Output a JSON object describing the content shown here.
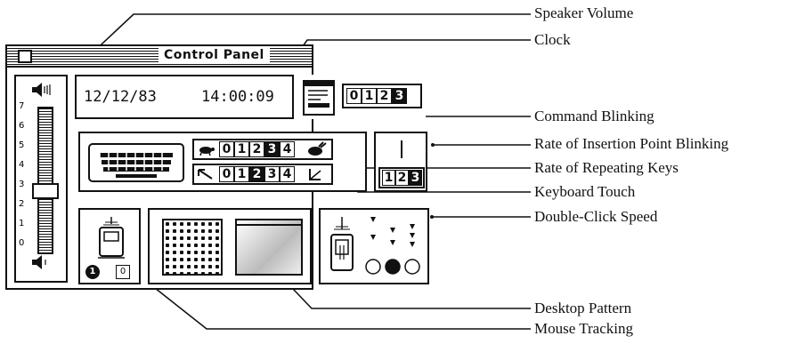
{
  "window": {
    "title": "Control Panel"
  },
  "clock": {
    "date": "12/12/83",
    "time": "14:00:09"
  },
  "command_blinking": {
    "digits": [
      "0",
      "1",
      "2",
      "3"
    ],
    "selected": 3
  },
  "insertion_blinking": {
    "digits": [
      "1",
      "2",
      "3"
    ],
    "selected": 2
  },
  "repeat_rate": {
    "digits": [
      "0",
      "1",
      "2",
      "3",
      "4"
    ],
    "selected": 3
  },
  "keyboard_touch": {
    "digits": [
      "0",
      "1",
      "2",
      "3",
      "4"
    ],
    "selected": 2
  },
  "speaker_volume": {
    "scale": [
      "7",
      "6",
      "5",
      "4",
      "3",
      "2",
      "1",
      "0"
    ],
    "level": 3
  },
  "mouse_tracking": {
    "options": [
      "1",
      "0"
    ],
    "selected": 0
  },
  "double_click": {
    "selected": 1
  },
  "callouts": {
    "speaker_volume": "Speaker Volume",
    "clock": "Clock",
    "command_blinking": "Command Blinking",
    "insertion_blinking": "Rate of Insertion Point Blinking",
    "repeating_keys": "Rate of Repeating Keys",
    "keyboard_touch": "Keyboard Touch",
    "double_click": "Double-Click Speed",
    "desktop_pattern": "Desktop Pattern",
    "mouse_tracking": "Mouse Tracking"
  }
}
